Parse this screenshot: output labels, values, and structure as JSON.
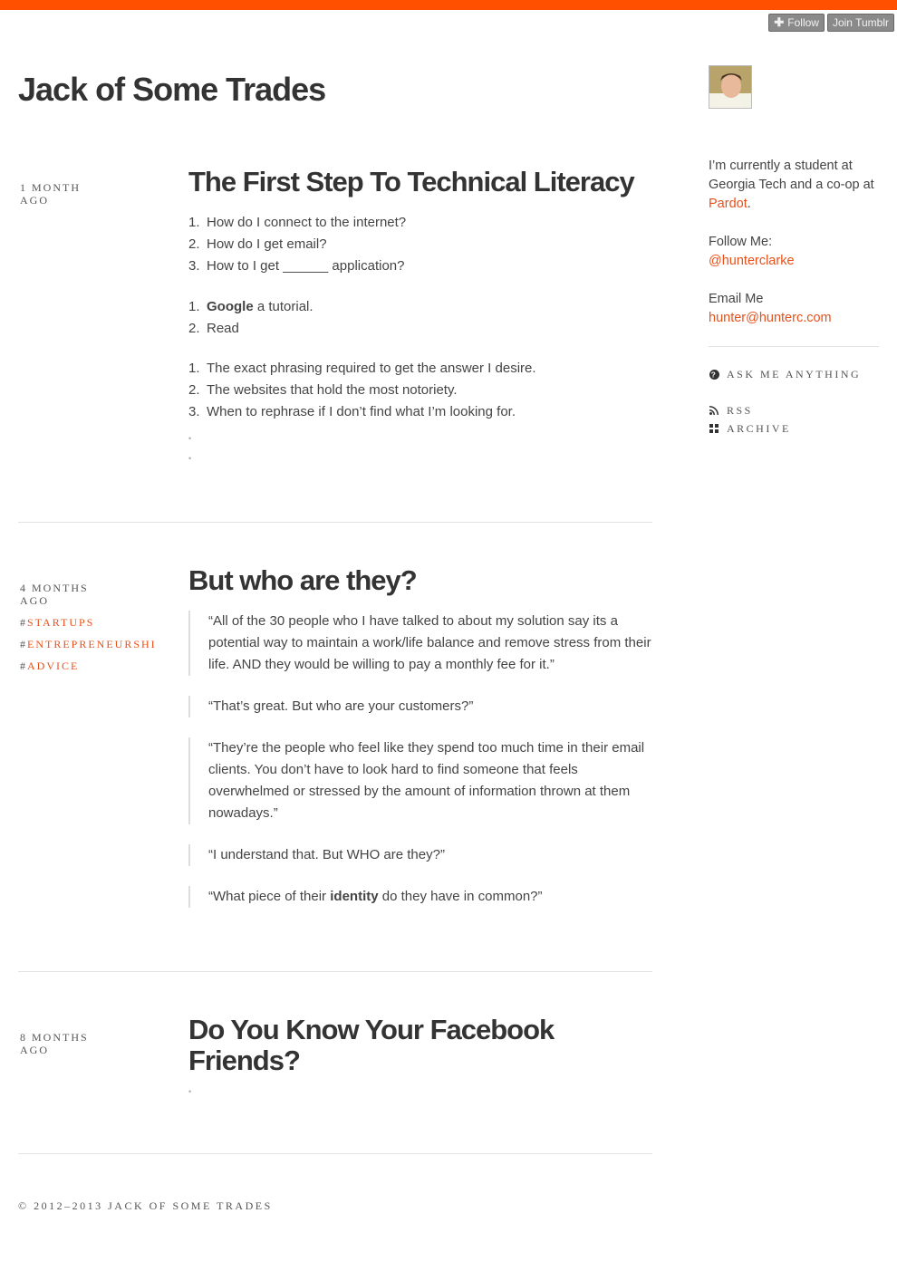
{
  "tumblr_controls": {
    "follow_label": "Follow",
    "join_label": "Join Tumblr"
  },
  "blog": {
    "title": "Jack of Some Trades"
  },
  "posts": [
    {
      "age_line1": "1 Month",
      "age_line2": "ago",
      "title": "The First Step To Technical Literacy",
      "list1": [
        "How do I connect to the internet?",
        "How do I get email?",
        "How to I get ______ application?"
      ],
      "list2_item1_bold": "Google",
      "list2_item1_rest": " a tutorial.",
      "list2_item2": "Read",
      "list3": [
        "The exact phrasing required to get the answer I desire.",
        "The websites that hold the most notoriety.",
        "When to rephrase if I don’t find what I’m looking for."
      ]
    },
    {
      "age_line1": "4 Months",
      "age_line2": "ago",
      "tags": [
        "startups",
        "entrepreneurshi",
        "advice"
      ],
      "title": "But who are they?",
      "quotes": [
        "“All of the 30 people who I have talked to about my solution say its a potential way to maintain a work/life balance and remove stress from their life. AND they would be willing to pay a monthly fee for it.”",
        "“That’s great. But who are your customers?”",
        "“They’re the people who feel like they spend too much time in their email clients. You don’t have to look hard to find someone that feels overwhelmed or stressed by the amount of information thrown at them nowadays.”",
        "“I understand that. But WHO are they?”"
      ],
      "quote5_before": "“What piece of their ",
      "quote5_bold": "identity",
      "quote5_after": " do they have in common?”"
    },
    {
      "age_line1": "8 Months",
      "age_line2": "ago",
      "title": "Do You Know Your Facebook Friends?"
    }
  ],
  "sidebar": {
    "bio_before": "I’m currently a student at Georgia Tech and a co-op at ",
    "bio_link": "Pardot",
    "bio_after": ".",
    "follow_label": "Follow Me:",
    "follow_link": "@hunterclarke",
    "email_label": "Email Me",
    "email_link": "hunter@hunterc.com",
    "nav": {
      "ask": "Ask me anything",
      "rss": "RSS",
      "archive": "Archive"
    }
  },
  "footer": {
    "text": "© 2012–2013 Jack of Some Trades"
  },
  "colors": {
    "accent": "#e8501a",
    "top_bar": "#ff5000"
  }
}
